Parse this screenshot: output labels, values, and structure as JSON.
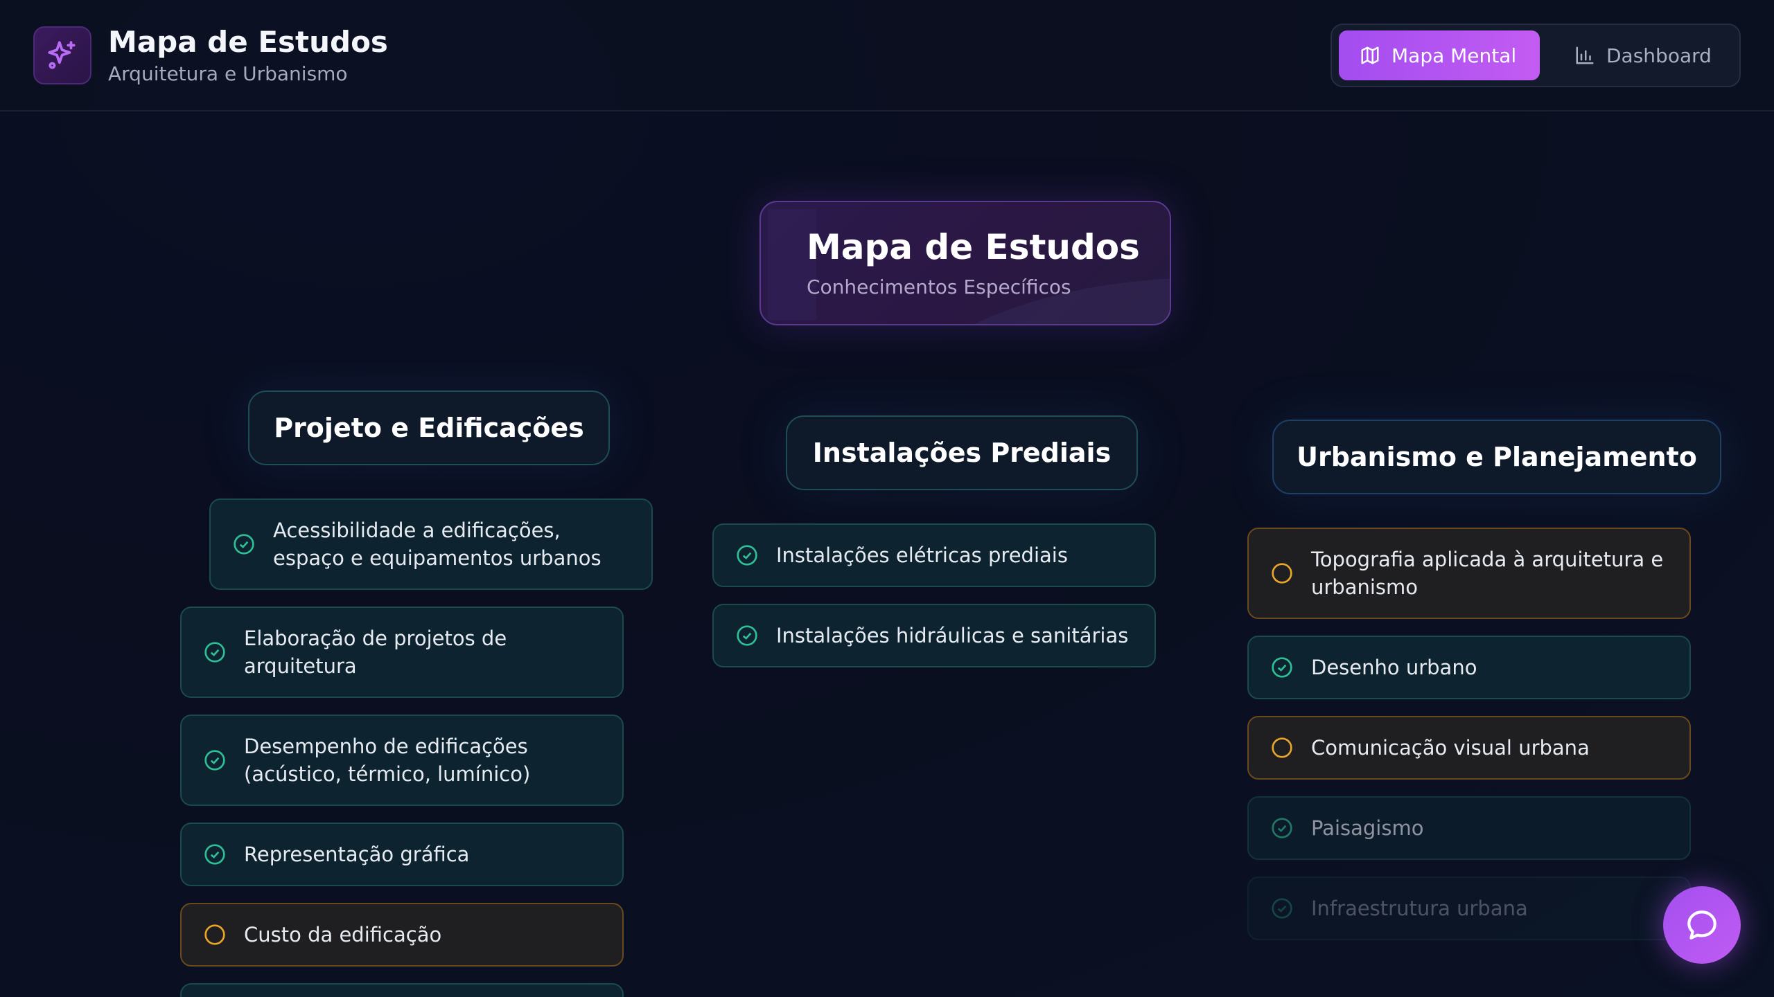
{
  "header": {
    "title": "Mapa de Estudos",
    "subtitle": "Arquitetura e Urbanismo",
    "logo_icon": "sparkles-icon",
    "tabs": [
      {
        "label": "Mapa Mental",
        "icon": "map-icon",
        "active": true
      },
      {
        "label": "Dashboard",
        "icon": "bar-chart-icon",
        "active": false
      }
    ]
  },
  "root": {
    "title": "Mapa de Estudos",
    "subtitle": "Conhecimentos Específicos"
  },
  "branches": [
    {
      "title": "Projeto e Edificações",
      "topics": [
        {
          "label": "Acessibilidade a edificações, espaço e equipamentos urbanos",
          "status": "done"
        },
        {
          "label": "Elaboração de projetos de arquitetura",
          "status": "done"
        },
        {
          "label": "Desempenho de edificações (acústico, térmico, lumínico)",
          "status": "done"
        },
        {
          "label": "Representação gráfica",
          "status": "done"
        },
        {
          "label": "Custo da edificação",
          "status": "pending"
        }
      ]
    },
    {
      "title": "Instalações Prediais",
      "topics": [
        {
          "label": "Instalações elétricas prediais",
          "status": "done"
        },
        {
          "label": "Instalações hidráulicas e sanitárias",
          "status": "done"
        }
      ]
    },
    {
      "title": "Urbanismo e Planejamento",
      "topics": [
        {
          "label": "Topografia aplicada à arquitetura e urbanismo",
          "status": "pending"
        },
        {
          "label": "Desenho urbano",
          "status": "done"
        },
        {
          "label": "Comunicação visual urbana",
          "status": "pending"
        },
        {
          "label": "Paisagismo",
          "status": "done"
        },
        {
          "label": "Infraestrutura urbana",
          "status": "done"
        }
      ]
    }
  ],
  "colors": {
    "accent": "#b356f1",
    "done": "#2fbf96",
    "pending": "#e8a72a"
  },
  "chat": {
    "icon": "chat-bubble-icon"
  }
}
